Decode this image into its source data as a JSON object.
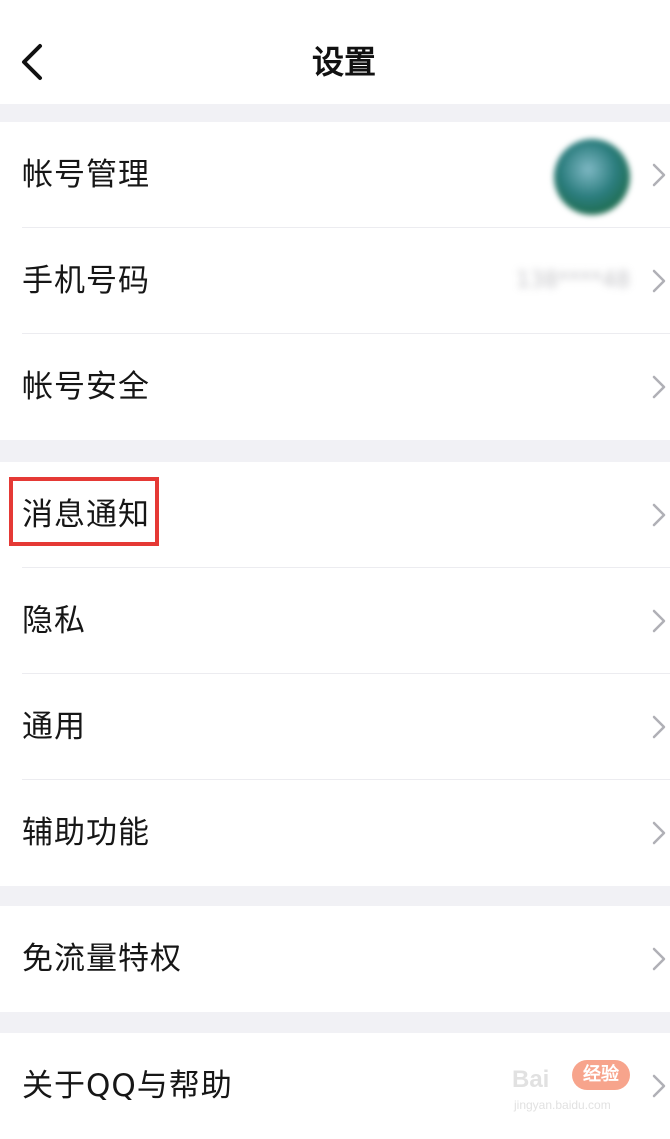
{
  "header": {
    "title": "设置",
    "back_icon": "chevron-left-icon"
  },
  "groups": [
    {
      "items": [
        {
          "label": "帐号管理",
          "trailing": "avatar"
        },
        {
          "label": "手机号码",
          "trailing": "masked-phone",
          "value": "138****48"
        },
        {
          "label": "帐号安全"
        }
      ]
    },
    {
      "items": [
        {
          "label": "消息通知",
          "highlighted": true
        },
        {
          "label": "隐私"
        },
        {
          "label": "通用"
        },
        {
          "label": "辅助功能"
        }
      ]
    },
    {
      "items": [
        {
          "label": "免流量特权"
        }
      ]
    },
    {
      "items": [
        {
          "label": "关于QQ与帮助"
        }
      ]
    }
  ],
  "watermark": {
    "main": "Bai",
    "badge": "经验",
    "sub": "jingyan.baidu.com"
  },
  "colors": {
    "background": "#f1f1f5",
    "highlight_border": "#e53935",
    "chevron": "#b0b0b6",
    "badge": "#f25b2f"
  }
}
